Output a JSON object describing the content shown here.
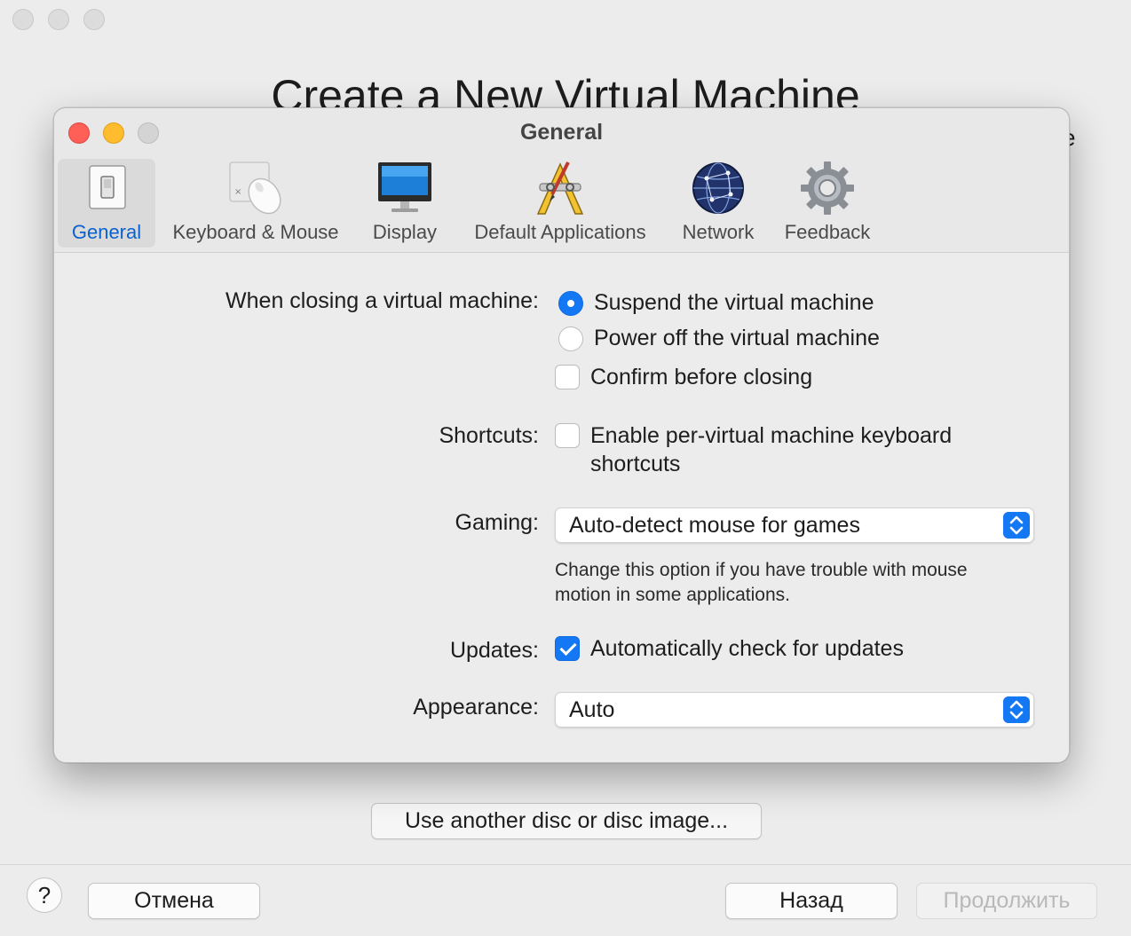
{
  "background": {
    "title": "Create a New Virtual Machine",
    "edge_char": "e",
    "disc_button": "Use another disc or disc image...",
    "help_label": "?",
    "cancel_label": "Отмена",
    "back_label": "Назад",
    "continue_label": "Продолжить"
  },
  "prefs": {
    "title": "General",
    "tabs": [
      {
        "label": "General",
        "icon": "general-switch-icon",
        "active": true
      },
      {
        "label": "Keyboard & Mouse",
        "icon": "keyboard-mouse-icon"
      },
      {
        "label": "Display",
        "icon": "display-monitor-icon"
      },
      {
        "label": "Default Applications",
        "icon": "default-applications-icon"
      },
      {
        "label": "Network",
        "icon": "network-globe-icon"
      },
      {
        "label": "Feedback",
        "icon": "feedback-gear-icon"
      }
    ],
    "closing": {
      "label": "When closing a virtual machine:",
      "suspend": "Suspend the virtual machine",
      "power_off": "Power off the virtual machine",
      "confirm": "Confirm before closing",
      "selected": "suspend",
      "confirm_checked": false
    },
    "shortcuts": {
      "label": "Shortcuts:",
      "line1": "Enable per-virtual machine keyboard",
      "line2": "shortcuts",
      "checked": false
    },
    "gaming": {
      "label": "Gaming:",
      "value": "Auto-detect mouse for games",
      "hint_line1": "Change this option if you have trouble with mouse",
      "hint_line2": "motion in some applications."
    },
    "updates": {
      "label": "Updates:",
      "option": "Automatically check for updates",
      "checked": true
    },
    "appearance": {
      "label": "Appearance:",
      "value": "Auto"
    },
    "colors": {
      "accent": "#1478f5",
      "active_tab_text": "#0a62d0",
      "close": "#fe5f57",
      "minimize": "#febc2e",
      "zoom_disabled": "#d4d4d4"
    }
  }
}
